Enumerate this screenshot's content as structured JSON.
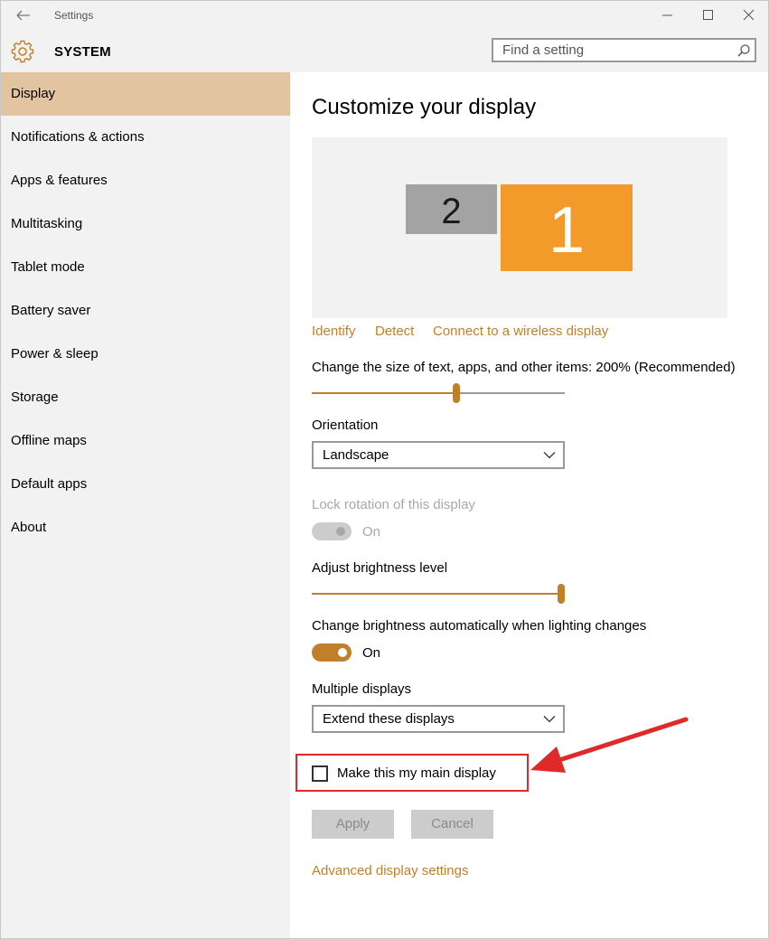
{
  "window": {
    "title": "Settings",
    "section_title": "SYSTEM",
    "search_placeholder": "Find a setting"
  },
  "sidebar": {
    "items": [
      {
        "label": "Display",
        "active": true
      },
      {
        "label": "Notifications & actions"
      },
      {
        "label": "Apps & features"
      },
      {
        "label": "Multitasking"
      },
      {
        "label": "Tablet mode"
      },
      {
        "label": "Battery saver"
      },
      {
        "label": "Power & sleep"
      },
      {
        "label": "Storage"
      },
      {
        "label": "Offline maps"
      },
      {
        "label": "Default apps"
      },
      {
        "label": "About"
      }
    ]
  },
  "main": {
    "title": "Customize your display",
    "monitors": {
      "secondary": "2",
      "primary": "1"
    },
    "links": {
      "identify": "Identify",
      "detect": "Detect",
      "wireless": "Connect to a wireless display",
      "advanced": "Advanced display settings"
    },
    "scale": {
      "label": "Change the size of text, apps, and other items: 200% (Recommended)",
      "position": 0.57
    },
    "orientation": {
      "label": "Orientation",
      "value": "Landscape"
    },
    "lock_rotation": {
      "label": "Lock rotation of this display",
      "state_text": "On",
      "enabled": false
    },
    "brightness": {
      "label": "Adjust brightness level",
      "value": 1.0
    },
    "auto_brightness": {
      "label": "Change brightness automatically when lighting changes",
      "state_text": "On",
      "on": true
    },
    "multiple_displays": {
      "label": "Multiple displays",
      "value": "Extend these displays"
    },
    "main_display": {
      "label": "Make this my main display",
      "checked": false
    },
    "buttons": {
      "apply": "Apply",
      "cancel": "Cancel"
    }
  },
  "colors": {
    "accent": "#c0802a",
    "active_nav": "#e2c4a0",
    "primary_monitor": "#f29a2a",
    "secondary_monitor": "#a3a3a3",
    "annotation": "#e02a2a"
  }
}
